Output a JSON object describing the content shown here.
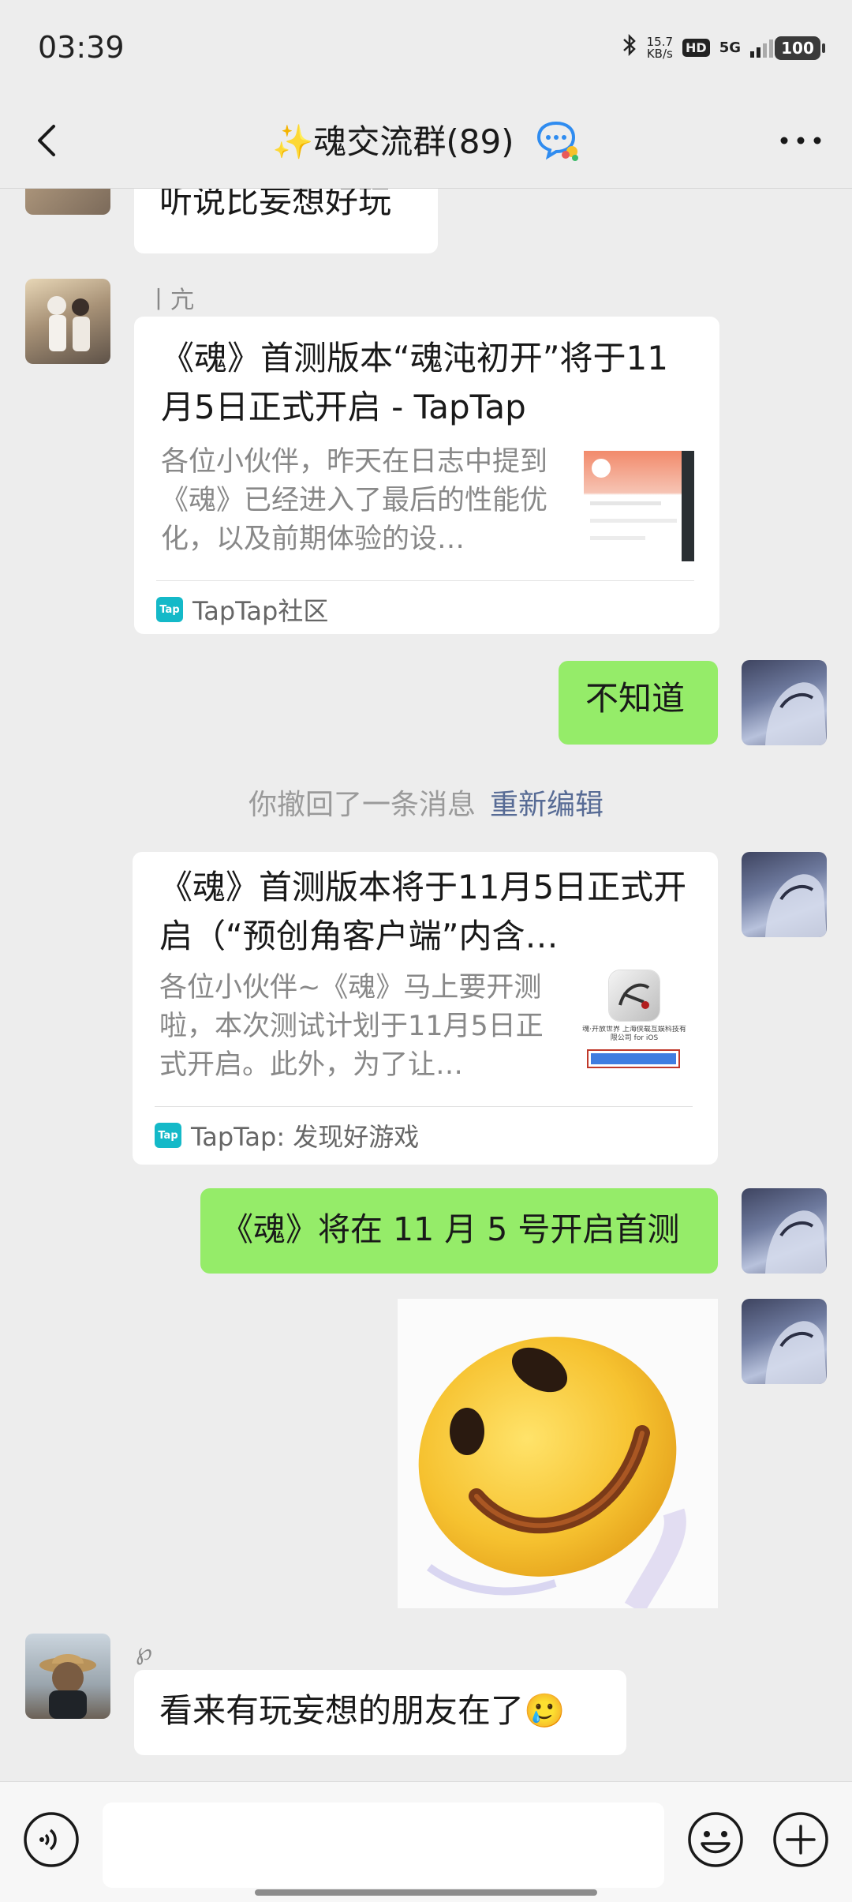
{
  "status": {
    "time": "03:39",
    "speed_value": "15.7",
    "speed_unit": "KB/s",
    "hd": "HD",
    "network": "5G",
    "battery": "100"
  },
  "header": {
    "title": "✨魂交流群(89)"
  },
  "messages": {
    "m1_text": "听说比妄想好玩",
    "m2_sender": "丨亢",
    "m2_card": {
      "title": "《魂》首测版本“魂沌初开”将于11月5日正式开启 - TapTap",
      "desc": "各位小伙伴，昨天在日志中提到《魂》已经进入了最后的性能优化，以及前期体验的设…",
      "source": "TapTap社区"
    },
    "m3_text": "不知道",
    "recall_notice": "你撤回了一条消息",
    "recall_link": "重新编辑",
    "m4_card": {
      "title": "《魂》首测版本将于11月5日正式开启（“预创角客户端”内含…",
      "desc": "各位小伙伴~《魂》马上要开测啦，本次测试计划于11月5日正式开启。此外，为了让…",
      "source": "TapTap: 发现好游戏",
      "thumb_caption": "魂·开放世界 上海侠载互娱科技有限公司 for iOS"
    },
    "m5_text": "《魂》将在 11 月 5 号开启首测",
    "m7_sender": "℘",
    "m7_text": "看来有玩妄想的朋友在了🥲"
  },
  "icons": {
    "back": "back-arrow-icon",
    "more": "more-dots-icon",
    "voice": "voice-icon",
    "emoji": "emoji-icon",
    "plus": "plus-icon",
    "tap_logo": "Tap"
  },
  "colors": {
    "background": "#ededed",
    "self_bubble": "#95ec69",
    "link": "#576b95"
  }
}
